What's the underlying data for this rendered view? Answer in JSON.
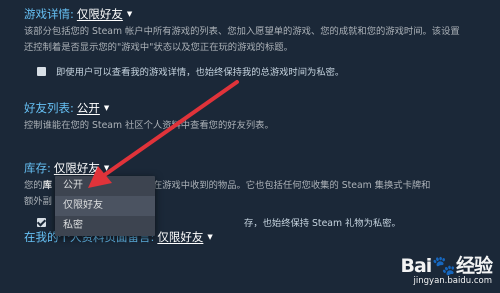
{
  "sections": {
    "game_details": {
      "title": "游戏详情:",
      "value": "仅限好友",
      "desc_line1": "该部分包括您的 Steam 帐户中所有游戏的列表、您加入愿望单的游戏、您的成就和您的游戏时间。该设置",
      "desc_line2": "还控制着是否显示您的\"游戏中\"状态以及您正在玩的游戏的标题。",
      "checkbox_label": "即使用户可以查看我的游戏详情，也始终保持我的总游戏时间为私密。"
    },
    "friends_list": {
      "title": "好友列表:",
      "value": "公开",
      "desc": "控制谁能在您的 Steam 社区个人资料中查看您的好友列表。"
    },
    "inventory": {
      "title": "库存:",
      "value": "仅限好友",
      "desc_line1_a": "您的",
      "desc_line1_b": "库",
      "desc_line1_c": "易功能在游戏中收到的物品。它也包括任何您收集的 Steam 集换式卡牌和",
      "desc_line2": "额外副",
      "checkbox_label": "存，也始终保持 Steam 礼物为私密。"
    },
    "profile_comments": {
      "title": "在我的个人资料页面留言:",
      "value": "仅限好友"
    }
  },
  "dropdown": {
    "options": [
      "公开",
      "仅限好友",
      "私密"
    ],
    "hovered": "仅限好友"
  },
  "watermark": {
    "logo_a": "Bai",
    "logo_b": "经验",
    "url": "jingyan.baidu.com"
  },
  "colors": {
    "background": "#1b2838",
    "title": "#66c0f4",
    "value": "#ffffff",
    "text": "#acb2b8",
    "dropdown_bg": "#3d4450",
    "arrow": "#e0333a"
  },
  "icons": {
    "caret": "caret-down-icon",
    "checkbox": "checkbox-icon",
    "arrow": "red-annotation-arrow",
    "paw": "baidu-paw-icon"
  }
}
